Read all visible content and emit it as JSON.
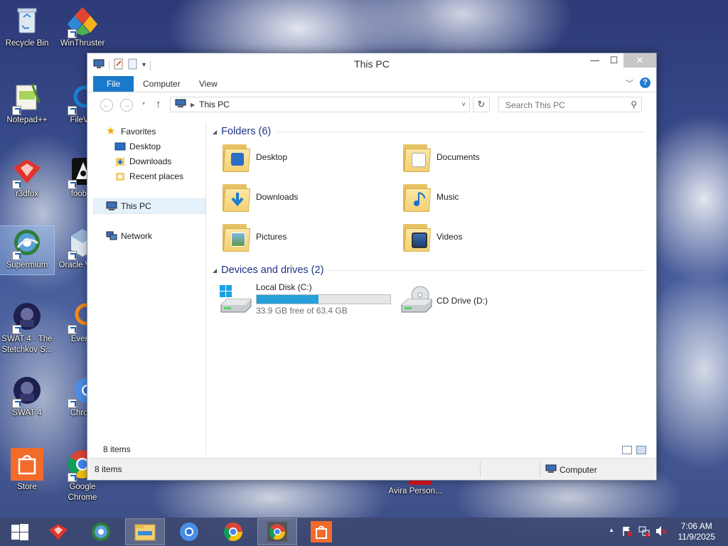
{
  "desktop": {
    "icons": [
      {
        "label": "Recycle Bin"
      },
      {
        "label": "WinThruster"
      },
      {
        "label": "Notepad++"
      },
      {
        "label": "FileVie"
      },
      {
        "label": "r3dfox"
      },
      {
        "label": "foobar"
      },
      {
        "label": "Supermium"
      },
      {
        "label": "Oracle Virtua"
      },
      {
        "label": "SWAT 4 - The Stetchkov S..."
      },
      {
        "label": "Everyt"
      },
      {
        "label": "SWAT 4"
      },
      {
        "label": "Chrom"
      },
      {
        "label": "Store"
      },
      {
        "label": "Google Chrome"
      },
      {
        "label": "Avira Person..."
      }
    ]
  },
  "window": {
    "title": "This PC",
    "ribbon_tabs": {
      "file": "File",
      "computer": "Computer",
      "view": "View"
    },
    "help": "?",
    "address": {
      "text": "This PC",
      "dropdown": "˅"
    },
    "search_placeholder": "Search This PC",
    "nav": {
      "favorites": "Favorites",
      "desktop": "Desktop",
      "downloads": "Downloads",
      "recent": "Recent places",
      "this_pc": "This PC",
      "network": "Network"
    },
    "folders_header": "Folders (6)",
    "folders": [
      {
        "name": "Desktop"
      },
      {
        "name": "Documents"
      },
      {
        "name": "Downloads"
      },
      {
        "name": "Music"
      },
      {
        "name": "Pictures"
      },
      {
        "name": "Videos"
      }
    ],
    "devices_header": "Devices and drives (2)",
    "drives": [
      {
        "name": "Local Disk (C:)",
        "free_text": "33.9 GB free of 63.4 GB",
        "used_fraction": 0.465
      },
      {
        "name": "CD Drive (D:)"
      }
    ],
    "item_count": "8 items",
    "status": {
      "left": "8 items",
      "right": "Computer"
    }
  },
  "taskbar": {
    "clock_time": "7:06 AM",
    "clock_date": "11/9/2025"
  },
  "colors": {
    "accent": "#1979ca",
    "progress": "#26a0da",
    "close": "#c7c7c7"
  }
}
